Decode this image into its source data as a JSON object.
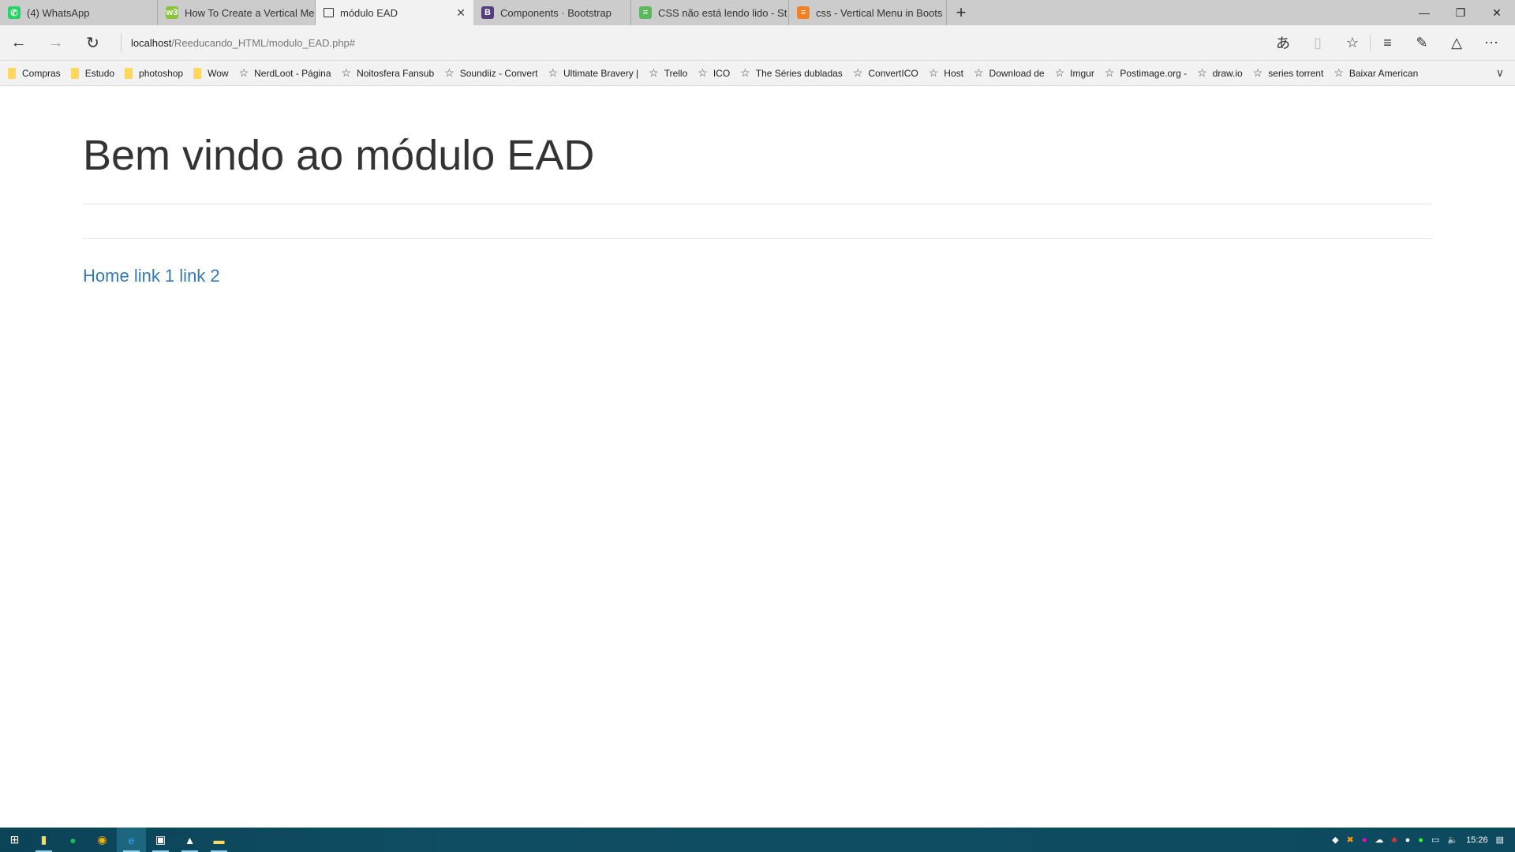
{
  "browser": {
    "tabs": [
      {
        "title": "(4) WhatsApp",
        "icon": "whatsapp-icon",
        "color": "#25d366",
        "glyph": "✆"
      },
      {
        "title": "How To Create a Vertical Me",
        "icon": "w3schools-icon",
        "color": "#8ac43f",
        "glyph": "w3"
      },
      {
        "title": "módulo EAD",
        "icon": "page-icon",
        "color": "#f2f2f2",
        "glyph": "",
        "active": true
      },
      {
        "title": "Components · Bootstrap",
        "icon": "bootstrap-icon",
        "color": "#563d7c",
        "glyph": "B"
      },
      {
        "title": "CSS não está lendo lido - St",
        "icon": "stackoverflow-icon",
        "color": "#5cb85c",
        "glyph": "≡"
      },
      {
        "title": "css - Vertical Menu in Boots",
        "icon": "stackoverflow-icon",
        "color": "#f48024",
        "glyph": "≡"
      }
    ],
    "new_tab": "+",
    "url_host": "localhost",
    "url_path": "/Reeducando_HTML/modulo_EAD.php#",
    "bookmarks": [
      {
        "label": "Compras",
        "type": "folder"
      },
      {
        "label": "Estudo",
        "type": "folder"
      },
      {
        "label": "photoshop",
        "type": "folder"
      },
      {
        "label": "Wow",
        "type": "folder"
      },
      {
        "label": "NerdLoot - Página",
        "type": "link"
      },
      {
        "label": "Noitosfera Fansub",
        "type": "link"
      },
      {
        "label": "Soundiiz - Convert",
        "type": "link"
      },
      {
        "label": "Ultimate Bravery |",
        "type": "link"
      },
      {
        "label": "Trello",
        "type": "link"
      },
      {
        "label": "ICO",
        "type": "link"
      },
      {
        "label": "The Séries dubladas",
        "type": "link"
      },
      {
        "label": "ConvertICO",
        "type": "link"
      },
      {
        "label": "Host",
        "type": "link"
      },
      {
        "label": "Download de",
        "type": "link"
      },
      {
        "label": "Imgur",
        "type": "link"
      },
      {
        "label": "Postimage.org -",
        "type": "link"
      },
      {
        "label": "draw.io",
        "type": "link"
      },
      {
        "label": "series torrent",
        "type": "link"
      },
      {
        "label": "Baixar American",
        "type": "link"
      }
    ]
  },
  "page": {
    "heading": "Bem vindo ao módulo EAD",
    "links": [
      "Home",
      "link 1",
      "link 2"
    ],
    "link_color": "#337ab7"
  },
  "taskbar": {
    "clock": "15:26"
  }
}
